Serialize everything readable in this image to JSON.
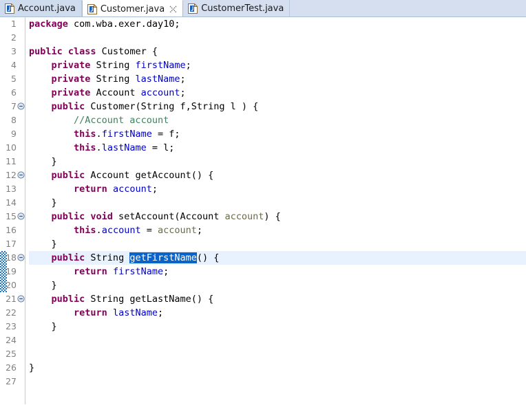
{
  "window": {
    "application": "Eclipse IDE",
    "view": "Java Editor"
  },
  "tabbar": {
    "tabs": [
      {
        "label": "Account.java",
        "icon": "java-file-icon",
        "active": false,
        "closable": false,
        "dirty": false
      },
      {
        "label": "Customer.java",
        "icon": "java-file-icon",
        "active": true,
        "closable": true,
        "close_icon": "close-icon",
        "dirty": false
      },
      {
        "label": "CustomerTest.java",
        "icon": "java-file-icon",
        "active": false,
        "closable": false,
        "dirty": false
      }
    ]
  },
  "editor": {
    "file": "Customer.java",
    "current_line": 18,
    "selection": {
      "text": "getFirstName",
      "line": 18
    },
    "change_bar_lines": [
      18,
      19,
      20
    ],
    "fold_marker_icon": "collapse-minus-icon",
    "line_numbers": [
      1,
      2,
      3,
      4,
      5,
      6,
      7,
      8,
      9,
      10,
      11,
      12,
      13,
      14,
      15,
      16,
      17,
      18,
      19,
      20,
      21,
      22,
      23,
      24,
      25,
      26,
      27
    ],
    "folding_rows": [
      7,
      12,
      15,
      18,
      21
    ],
    "colors": {
      "keyword": "#7f0055",
      "field": "#0000c0",
      "parameter": "#6a6a4a",
      "comment": "#3f7f5f",
      "plain": "#000000",
      "selection_bg": "#0a64c8",
      "selection_fg": "#ffffff",
      "current_line_bg": "#e8f2fe",
      "change_bar": "#1978d2",
      "tab_bar_bg": "#d5dfef",
      "active_tab_bg": "#ffffff",
      "gutter_fg": "#808080"
    },
    "lines": [
      {
        "n": 1,
        "fold": false,
        "tokens": [
          {
            "t": "kw",
            "v": "package"
          },
          {
            "t": "pl",
            "v": " com.wba.exer.day10;"
          }
        ]
      },
      {
        "n": 2,
        "fold": false,
        "tokens": []
      },
      {
        "n": 3,
        "fold": false,
        "tokens": [
          {
            "t": "kw",
            "v": "public class"
          },
          {
            "t": "pl",
            "v": " Customer {"
          }
        ]
      },
      {
        "n": 4,
        "fold": false,
        "tokens": [
          {
            "t": "pl",
            "v": "    "
          },
          {
            "t": "kw",
            "v": "private"
          },
          {
            "t": "pl",
            "v": " String "
          },
          {
            "t": "fld",
            "v": "firstName"
          },
          {
            "t": "pl",
            "v": ";"
          }
        ]
      },
      {
        "n": 5,
        "fold": false,
        "tokens": [
          {
            "t": "pl",
            "v": "    "
          },
          {
            "t": "kw",
            "v": "private"
          },
          {
            "t": "pl",
            "v": " String "
          },
          {
            "t": "fld",
            "v": "lastName"
          },
          {
            "t": "pl",
            "v": ";"
          }
        ]
      },
      {
        "n": 6,
        "fold": false,
        "tokens": [
          {
            "t": "pl",
            "v": "    "
          },
          {
            "t": "kw",
            "v": "private"
          },
          {
            "t": "pl",
            "v": " Account "
          },
          {
            "t": "fld",
            "v": "account"
          },
          {
            "t": "pl",
            "v": ";"
          }
        ]
      },
      {
        "n": 7,
        "fold": true,
        "tokens": [
          {
            "t": "pl",
            "v": "    "
          },
          {
            "t": "kw",
            "v": "public"
          },
          {
            "t": "pl",
            "v": " Customer(String f,String l ) {"
          }
        ]
      },
      {
        "n": 8,
        "fold": false,
        "tokens": [
          {
            "t": "pl",
            "v": "        "
          },
          {
            "t": "cmt",
            "v": "//Account account"
          }
        ]
      },
      {
        "n": 9,
        "fold": false,
        "tokens": [
          {
            "t": "pl",
            "v": "        "
          },
          {
            "t": "kw",
            "v": "this"
          },
          {
            "t": "pl",
            "v": "."
          },
          {
            "t": "fld",
            "v": "firstName"
          },
          {
            "t": "pl",
            "v": " = f;"
          }
        ]
      },
      {
        "n": 10,
        "fold": false,
        "tokens": [
          {
            "t": "pl",
            "v": "        "
          },
          {
            "t": "kw",
            "v": "this"
          },
          {
            "t": "pl",
            "v": "."
          },
          {
            "t": "fld",
            "v": "lastName"
          },
          {
            "t": "pl",
            "v": " = l;"
          }
        ]
      },
      {
        "n": 11,
        "fold": false,
        "tokens": [
          {
            "t": "pl",
            "v": "    }"
          }
        ]
      },
      {
        "n": 12,
        "fold": true,
        "tokens": [
          {
            "t": "pl",
            "v": "    "
          },
          {
            "t": "kw",
            "v": "public"
          },
          {
            "t": "pl",
            "v": " Account getAccount() {"
          }
        ]
      },
      {
        "n": 13,
        "fold": false,
        "tokens": [
          {
            "t": "pl",
            "v": "        "
          },
          {
            "t": "kw",
            "v": "return"
          },
          {
            "t": "pl",
            "v": " "
          },
          {
            "t": "fld",
            "v": "account"
          },
          {
            "t": "pl",
            "v": ";"
          }
        ]
      },
      {
        "n": 14,
        "fold": false,
        "tokens": [
          {
            "t": "pl",
            "v": "    }"
          }
        ]
      },
      {
        "n": 15,
        "fold": true,
        "tokens": [
          {
            "t": "pl",
            "v": "    "
          },
          {
            "t": "kw",
            "v": "public void"
          },
          {
            "t": "pl",
            "v": " setAccount(Account "
          },
          {
            "t": "par",
            "v": "account"
          },
          {
            "t": "pl",
            "v": ") {"
          }
        ]
      },
      {
        "n": 16,
        "fold": false,
        "tokens": [
          {
            "t": "pl",
            "v": "        "
          },
          {
            "t": "kw",
            "v": "this"
          },
          {
            "t": "pl",
            "v": "."
          },
          {
            "t": "fld",
            "v": "account"
          },
          {
            "t": "pl",
            "v": " = "
          },
          {
            "t": "par",
            "v": "account"
          },
          {
            "t": "pl",
            "v": ";"
          }
        ]
      },
      {
        "n": 17,
        "fold": false,
        "tokens": [
          {
            "t": "pl",
            "v": "    }"
          }
        ]
      },
      {
        "n": 18,
        "fold": true,
        "current": true,
        "tokens": [
          {
            "t": "pl",
            "v": "    "
          },
          {
            "t": "kw",
            "v": "public"
          },
          {
            "t": "pl",
            "v": " String "
          },
          {
            "t": "sel",
            "v": "getFirstName"
          },
          {
            "t": "pl",
            "v": "() {"
          }
        ]
      },
      {
        "n": 19,
        "fold": false,
        "tokens": [
          {
            "t": "pl",
            "v": "        "
          },
          {
            "t": "kw",
            "v": "return"
          },
          {
            "t": "pl",
            "v": " "
          },
          {
            "t": "fld",
            "v": "firstName"
          },
          {
            "t": "pl",
            "v": ";"
          }
        ]
      },
      {
        "n": 20,
        "fold": false,
        "tokens": [
          {
            "t": "pl",
            "v": "    }"
          }
        ]
      },
      {
        "n": 21,
        "fold": true,
        "tokens": [
          {
            "t": "pl",
            "v": "    "
          },
          {
            "t": "kw",
            "v": "public"
          },
          {
            "t": "pl",
            "v": " String getLastName() {"
          }
        ]
      },
      {
        "n": 22,
        "fold": false,
        "tokens": [
          {
            "t": "pl",
            "v": "        "
          },
          {
            "t": "kw",
            "v": "return"
          },
          {
            "t": "pl",
            "v": " "
          },
          {
            "t": "fld",
            "v": "lastName"
          },
          {
            "t": "pl",
            "v": ";"
          }
        ]
      },
      {
        "n": 23,
        "fold": false,
        "tokens": [
          {
            "t": "pl",
            "v": "    }"
          }
        ]
      },
      {
        "n": 24,
        "fold": false,
        "tokens": []
      },
      {
        "n": 25,
        "fold": false,
        "tokens": []
      },
      {
        "n": 26,
        "fold": false,
        "tokens": [
          {
            "t": "pl",
            "v": "}"
          }
        ]
      },
      {
        "n": 27,
        "fold": false,
        "tokens": []
      }
    ]
  }
}
